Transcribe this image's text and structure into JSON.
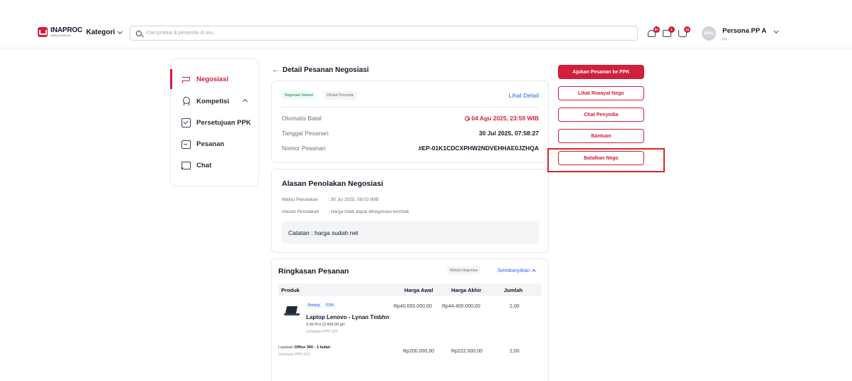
{
  "header": {
    "brand": "INAPROC",
    "brand_tagline": "Katalog Elektronik",
    "kategori_label": "Kategori",
    "search_placeholder": "Cari produk & penyedia di sini...",
    "icons": [
      {
        "name": "notification-bell-icon",
        "badge": "9+"
      },
      {
        "name": "inbox-icon",
        "badge": "1"
      },
      {
        "name": "cart-icon",
        "badge": "10"
      }
    ],
    "user": {
      "initials": "PPA",
      "name": "Persona PP A",
      "role": "PP"
    }
  },
  "sidebar": {
    "items": [
      {
        "label": "Negosiasi",
        "icon": "swap-icon",
        "active": true
      },
      {
        "label": "Kompetisi",
        "icon": "award-icon"
      },
      {
        "label": "Persetujuan PPK",
        "icon": "checkbox-icon"
      },
      {
        "label": "Pesanan",
        "icon": "package-icon"
      },
      {
        "label": "Chat",
        "icon": "chat-icon"
      }
    ]
  },
  "page": {
    "back_arrow": "←",
    "title": "Detail Pesanan Negosiasi"
  },
  "order_card": {
    "status_badge": "Negosiasi Selesai",
    "secondary_badge": "Ditolak Penyedia",
    "detail_link": "Lihat Detail",
    "rows": [
      {
        "label": "Otomatis Batal",
        "value": "04 Agu 2025, 23:59 WIB"
      },
      {
        "label": "Tanggal Pesanan",
        "value": "30 Jul 2025, 07:58:27"
      },
      {
        "label": "Nomor Pesanan",
        "value": "#EP-01K1CDCXPHW2NDVEHHAE0JZHQA"
      }
    ]
  },
  "rejection_card": {
    "title": "Alasan Penolakan Negosiasi",
    "time_label": "Waktu Penolakan",
    "time_value": ": 30 Jul 2025, 08:03 WIB",
    "reason_label": "Alasan Penolakan",
    "reason_value": ": Harga tidak dapat dinegosiasi kembali",
    "note": "Catatan : harga sudah net"
  },
  "summary_card": {
    "title": "Ringkasan Pesanan",
    "via_badge": "Melalui Negosiasi",
    "toggle_label": "Sembunyikan",
    "columns": [
      "Produk",
      "Harga Awal",
      "Harga Akhir",
      "Jumlah"
    ],
    "rows": [
      {
        "tags": [
          "Barang",
          "PDN"
        ],
        "name": "Laptop Lenovo - Lynan Tmbhn",
        "sub": "2,00 Pcs (2.666,00 gr)",
        "tax": "Golongan PPN 12%",
        "harga_awal": "Rp40.000.000,00",
        "harga_akhir": "Rp44.400.000,00",
        "jumlah": "2,00"
      },
      {
        "type": "Layanan",
        "name": "Office 360 - 1 bulan",
        "tax": "Golongan PPN 12%",
        "harga_awal": "Rp200.000,00",
        "harga_akhir": "Rp222.000,00",
        "jumlah": "2,00"
      }
    ]
  },
  "actions": {
    "submit_ppk": "Ajukan Pesanan ke PPK",
    "history": "Lihat Riwayat Nego",
    "chat": "Chat Penyedia",
    "help": "Bantuan",
    "cancel": "Batalkan Nego"
  },
  "colors": {
    "brand_red": "#d21f3c",
    "link_blue": "#2563eb",
    "success_green": "#15803d",
    "highlight": "#dc2626"
  }
}
